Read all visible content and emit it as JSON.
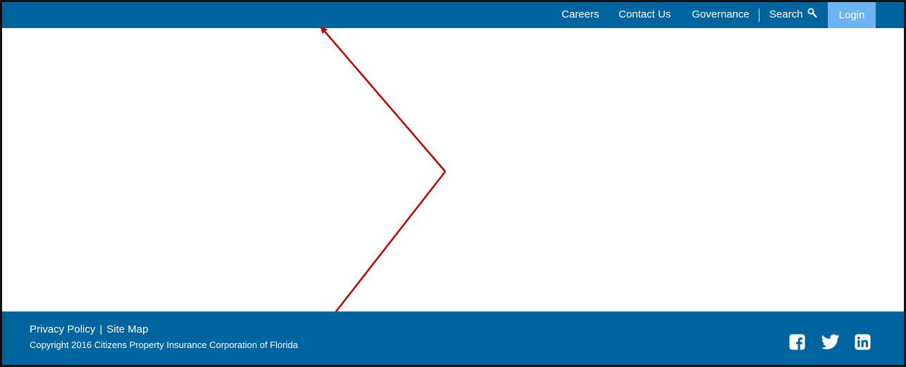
{
  "header": {
    "nav": [
      "Careers",
      "Contact Us",
      "Governance"
    ],
    "search_label": "Search",
    "login_label": "Login"
  },
  "footer": {
    "links": [
      "Privacy Policy",
      "Site Map"
    ],
    "separator": "|",
    "copyright": "Copyright 2016 Citizens Property Insurance Corporation of Florida",
    "social_icons": [
      "facebook-icon",
      "twitter-icon",
      "linkedin-icon"
    ]
  },
  "colors": {
    "brand_blue": "#00659f",
    "login_blue": "#6bb4f1",
    "annotation_red": "#c00000"
  }
}
